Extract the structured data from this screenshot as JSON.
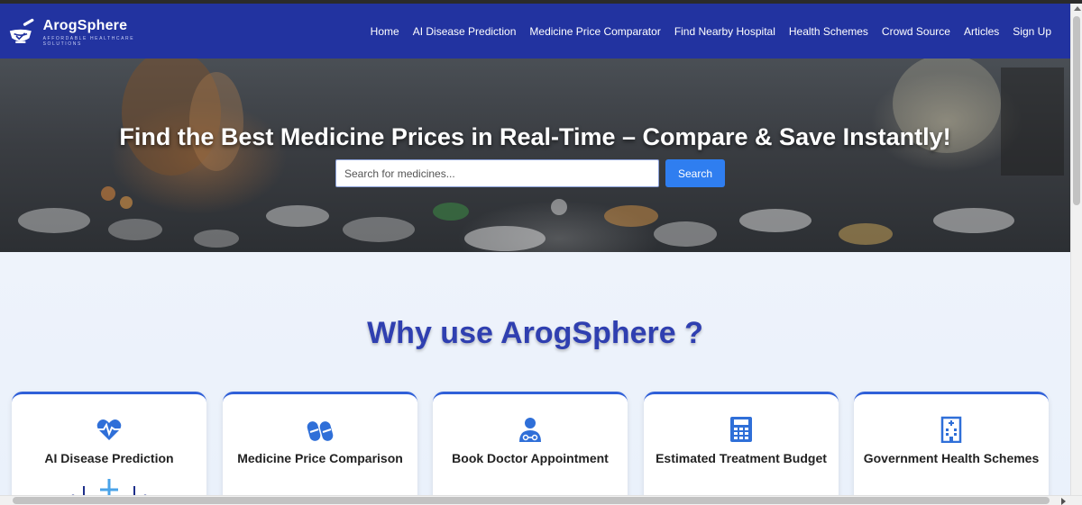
{
  "brand": {
    "name": "ArogSphere",
    "tagline": "AFFORDABLE HEALTHCARE SOLUTIONS",
    "color": "#2233a0"
  },
  "nav": {
    "items": [
      {
        "label": "Home"
      },
      {
        "label": "AI Disease Prediction"
      },
      {
        "label": "Medicine Price Comparator"
      },
      {
        "label": "Find Nearby Hospital"
      },
      {
        "label": "Health Schemes"
      },
      {
        "label": "Crowd Source"
      },
      {
        "label": "Articles"
      },
      {
        "label": "Sign Up"
      }
    ]
  },
  "hero": {
    "title": "Find the Best Medicine Prices in Real-Time – Compare & Save Instantly!",
    "search_placeholder": "Search for medicines...",
    "search_button": "Search",
    "button_color": "#2f7ef0"
  },
  "features": {
    "title": "Why use ArogSphere ?",
    "title_color": "#2f3fb0",
    "cards": [
      {
        "label": "AI Disease Prediction",
        "icon": "heart-pulse-icon"
      },
      {
        "label": "Medicine Price Comparison",
        "icon": "capsules-icon"
      },
      {
        "label": "Book Doctor Appointment",
        "icon": "doctor-icon"
      },
      {
        "label": "Estimated Treatment Budget",
        "icon": "calculator-icon"
      },
      {
        "label": "Government Health Schemes",
        "icon": "hospital-building-icon"
      }
    ],
    "icon_color": "#2f6fd8"
  }
}
